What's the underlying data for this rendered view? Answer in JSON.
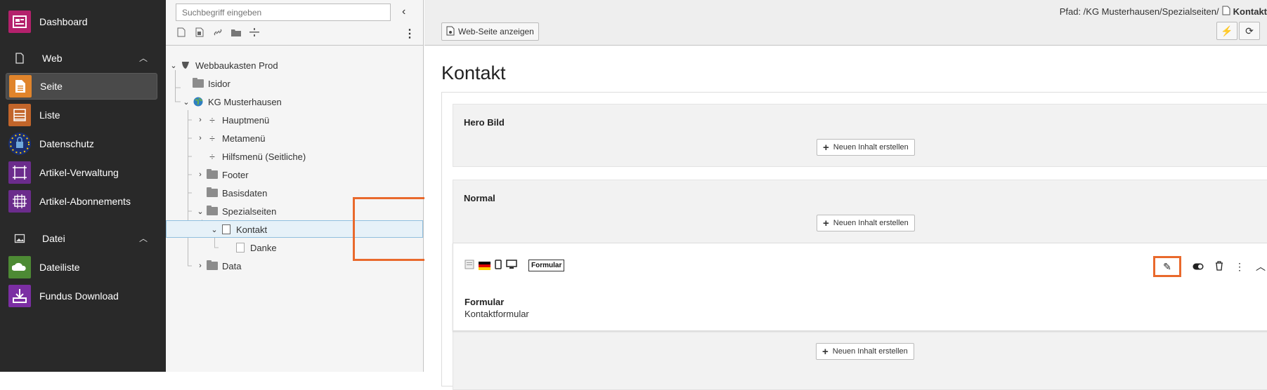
{
  "module_menu": {
    "items": [
      {
        "label": "Dashboard",
        "icon": "dashboard-icon",
        "color": "#b4216c"
      },
      {
        "label": "Web",
        "icon": "page-outline-icon",
        "group": true
      },
      {
        "label": "Seite",
        "icon": "page-module-icon",
        "color": "#e0842b",
        "active": true
      },
      {
        "label": "Liste",
        "icon": "list-module-icon",
        "color": "#c2652a"
      },
      {
        "label": "Datenschutz",
        "icon": "eu-privacy-icon",
        "color": "#003399"
      },
      {
        "label": "Artikel-Verwaltung",
        "icon": "article-management-icon",
        "color": "#6b2c8c"
      },
      {
        "label": "Artikel-Abonnements",
        "icon": "article-subscription-icon",
        "color": "#6b2c8c"
      },
      {
        "label": "Datei",
        "icon": "image-icon",
        "group": true
      },
      {
        "label": "Dateiliste",
        "icon": "file-list-icon",
        "color": "#4d8a34"
      },
      {
        "label": "Fundus Download",
        "icon": "download-icon",
        "color": "#7b2ea3"
      }
    ]
  },
  "tree": {
    "search_placeholder": "Suchbegriff eingeben",
    "nodes": [
      {
        "label": "Webbaukasten Prod",
        "type": "root",
        "exp": "⌄"
      },
      {
        "label": "Isidor",
        "type": "folder",
        "exp": ""
      },
      {
        "label": "KG Musterhausen",
        "type": "globe",
        "exp": "⌄"
      },
      {
        "label": "Hauptmenü",
        "type": "separator",
        "exp": "›"
      },
      {
        "label": "Metamenü",
        "type": "separator",
        "exp": "›"
      },
      {
        "label": "Hilfsmenü (Seitliche)",
        "type": "separator",
        "exp": ""
      },
      {
        "label": "Footer",
        "type": "folder",
        "exp": "›"
      },
      {
        "label": "Basisdaten",
        "type": "folder",
        "exp": ""
      },
      {
        "label": "Spezialseiten",
        "type": "folder",
        "exp": "⌄"
      },
      {
        "label": "Kontakt",
        "type": "page",
        "exp": "⌄"
      },
      {
        "label": "Danke",
        "type": "page-light",
        "exp": ""
      },
      {
        "label": "Data",
        "type": "folder",
        "exp": "›"
      }
    ]
  },
  "header": {
    "path_prefix": "Pfad: /KG Musterhausen/Spezialseiten/",
    "path_current": "Kontakt",
    "view_button": "Web-Seite anzeigen"
  },
  "main": {
    "title": "Kontakt",
    "new_content_label": "Neuen Inhalt erstellen",
    "col_hero": "Hero Bild",
    "col_normal": "Normal",
    "element": {
      "tag": "Formular",
      "title": "Formular",
      "subtitle": "Kontaktformular"
    }
  },
  "colors": {
    "highlight": "#e9692c",
    "selected_bg": "#e6f1f8"
  }
}
